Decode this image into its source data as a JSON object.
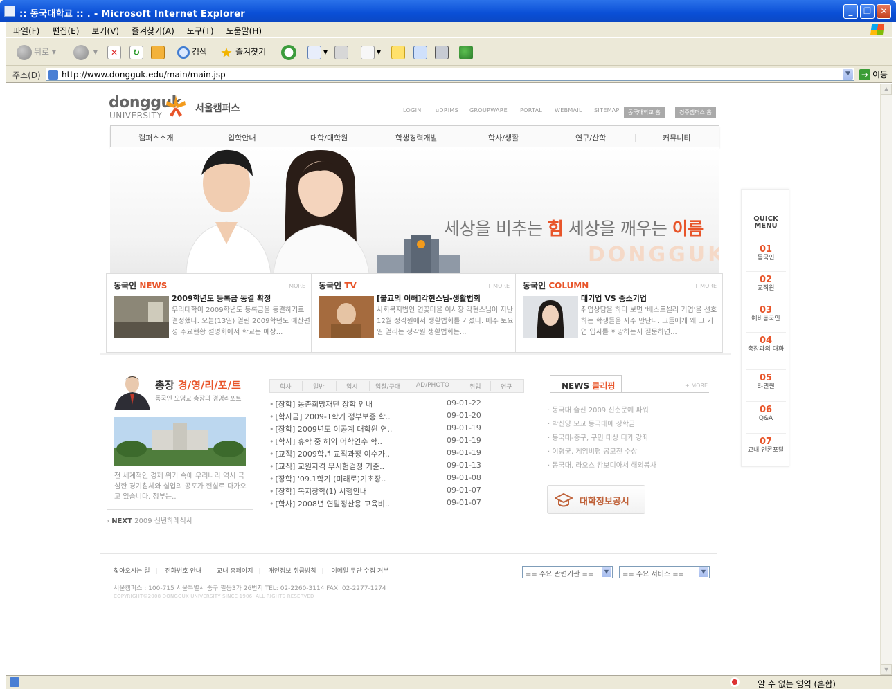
{
  "window": {
    "title": ":: 동국대학교 :: . - Microsoft Internet Explorer",
    "controls": {
      "minimize": "_",
      "restore": "❐",
      "close": "✕"
    }
  },
  "menubar": [
    "파일(F)",
    "편집(E)",
    "보기(V)",
    "즐겨찾기(A)",
    "도구(T)",
    "도움말(H)"
  ],
  "toolbar": {
    "back": "뒤로",
    "search": "검색",
    "favorites": "즐겨찾기"
  },
  "address": {
    "label": "주소(D)",
    "url": "http://www.dongguk.edu/main/main.jsp",
    "go": "이동"
  },
  "status": {
    "zone": "알 수 없는 영역 (혼합)"
  },
  "site": {
    "logo": {
      "name": "dongguk",
      "sub": "UNIVERSITY",
      "campus": "서울캠퍼스"
    },
    "gnb": [
      "LOGIN",
      "uDRIMS",
      "GROUPWARE",
      "PORTAL",
      "WEBMAIL",
      "SITEMAP"
    ],
    "gnb_buttons": [
      "동국대학교 홈",
      "경주캠퍼스 홈"
    ],
    "nav": [
      "캠퍼스소개",
      "입학안내",
      "대학/대학원",
      "학생경력개발",
      "학사/생활",
      "연구/산학",
      "커뮤니티"
    ],
    "slogan": {
      "p1": "세상을 비추는 ",
      "h1": "힘",
      "p2": " 세상을 깨우는 ",
      "h2": "이름"
    },
    "hero_watermark": "DONGGUK",
    "quick": {
      "title_1": "QUICK",
      "title_2": "MENU",
      "items": [
        {
          "num": "01",
          "label": "동국인"
        },
        {
          "num": "02",
          "label": "교직원"
        },
        {
          "num": "03",
          "label": "예비동국인"
        },
        {
          "num": "04",
          "label": "총장과의 대화"
        },
        {
          "num": "05",
          "label": "E-민원"
        },
        {
          "num": "06",
          "label": "Q&A"
        },
        {
          "num": "07",
          "label": "교내 언론포탈"
        }
      ]
    },
    "cards": [
      {
        "head_pre": "동국인 ",
        "head_hl": "NEWS",
        "more": "+ MORE",
        "title": "2009학년도 등록금 동결 확정",
        "body": "우리대학이 2009학년도 등록금을 동결하기로 결정했다. 오늘(13일) 열린 2009학년도 예산편성 주요현황 설명회에서 학교는 예상..."
      },
      {
        "head_pre": "동국인 ",
        "head_hl": "TV",
        "more": "+ MORE",
        "title": "[불교의 이해]각현스님-생활법회",
        "body": "사회복지법인 연꽃마을 이사장 각현스님이 지난 12월 정각원에서 생활법회를 가졌다. 매주 토요일 열리는 정각원 생활법회는..."
      },
      {
        "head_pre": "동국인 ",
        "head_hl": "COLUMN",
        "more": "+ MORE",
        "title": "대기업 VS 중소기업",
        "body": "취업상담을 하다 보면 '베스트셀러 기업'을 선호하는 학생들을 자주 만난다. 그들에게 왜 그 기업 입사를 희망하는지 질문하면..."
      }
    ],
    "president": {
      "title_pre": "총장 ",
      "title_hl": "경/영/리/포/트",
      "subtitle": "동국인 오영교 총장의 경영리포트",
      "text": "전 세계적인 경제 위기 속에 우리나라 역시 극심한 경기침체와 실업의 공포가 현실로 다가오고 있습니다. 정부는..",
      "next_label": "NEXT",
      "next_text": "2009 신년하례식사"
    },
    "notice_tabs": [
      "학사",
      "일반",
      "입시",
      "입찰/구매",
      "AD/PHOTO",
      "취업",
      "연구"
    ],
    "notices": [
      {
        "text": "[장학] 농촌희망재단 장학 안내",
        "date": "09-01-22"
      },
      {
        "text": "[학자금] 2009-1학기 정부보증 학..",
        "date": "09-01-20"
      },
      {
        "text": "[장학] 2009년도 이공계 대학원 연..",
        "date": "09-01-19"
      },
      {
        "text": "[학사] 휴학 중 해외 어학연수 학..",
        "date": "09-01-19"
      },
      {
        "text": "[교직] 2009학년 교직과정 이수가..",
        "date": "09-01-19"
      },
      {
        "text": "[교직] 교원자격 무시험검정 기준..",
        "date": "09-01-13"
      },
      {
        "text": "[장학] '09.1학기 (미래로)기초장..",
        "date": "09-01-08"
      },
      {
        "text": "[장학] 복지장학(1) 시행안내",
        "date": "09-01-07"
      },
      {
        "text": "[학사] 2008년 연말정산용 교육비..",
        "date": "09-01-07"
      }
    ],
    "clipping": {
      "title_pre": "NEWS ",
      "title_hl": "클리핑",
      "more": "+ MORE",
      "items": [
        "동국대 출신 2009 신춘문예 파워",
        "박신양 모교 동국대에 장학금",
        "동국대-중구, 구민 대상 디카 강좌",
        "이형균, 게임비평 공모전 수상",
        "동국대, 라오스 캄보디아서 해외봉사"
      ]
    },
    "daehak_button": "대학정보공시",
    "footer": {
      "links": [
        "찾아오시는 길",
        "전화번호 안내",
        "교내 홈페이지",
        "개인정보 취급방침",
        "이메일 무단 수집 거부"
      ],
      "address": "서울캠퍼스 : 100-715 서울특별시 중구 필동3가 26번지   TEL: 02-2260-3114   FAX: 02-2277-1274",
      "copyright": "COPYRIGHT©2008 DONGGUK UNIVERSITY SINCE 1906. ALL RIGHTS RESERVED",
      "select1": "== 주요 관련기관 ==",
      "select2": "== 주요 서비스 =="
    }
  }
}
